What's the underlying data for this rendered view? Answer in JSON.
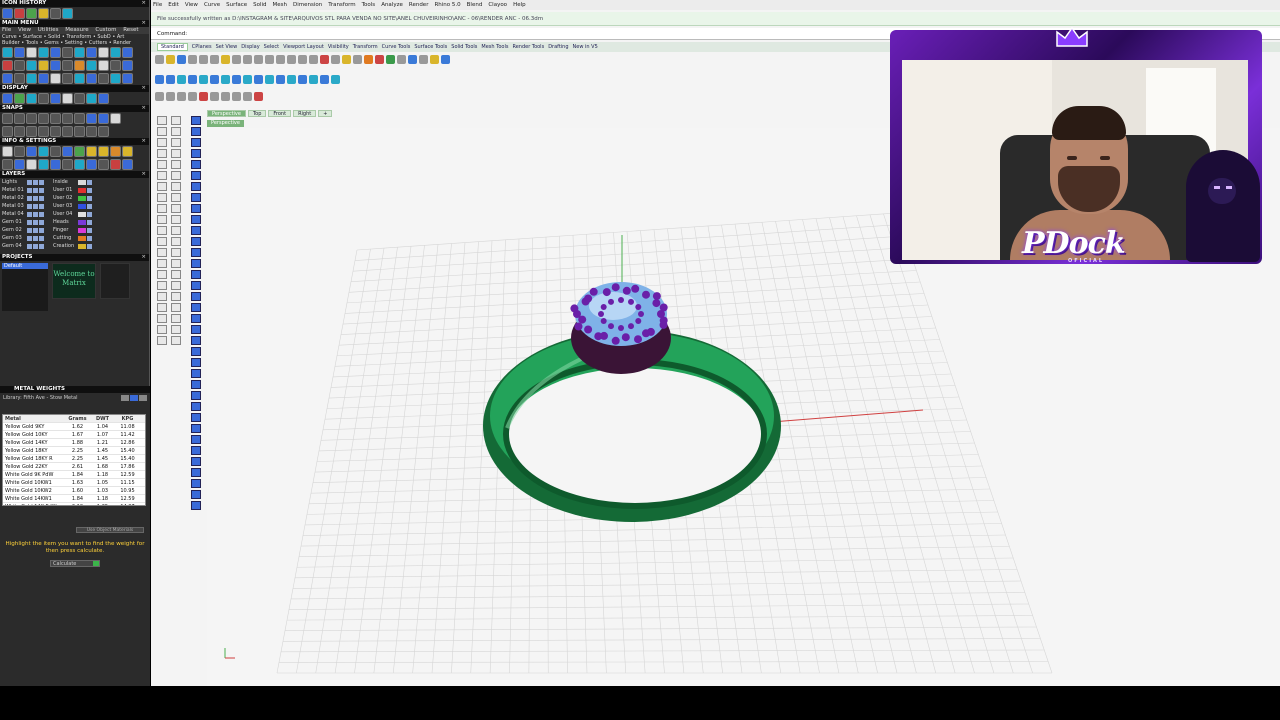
{
  "left_panel": {
    "icon_history_title": "ICON HISTORY",
    "main_menu_title": "MAIN MENU",
    "main_menu_items": [
      "File",
      "View",
      "Utilities",
      "Measure",
      "Custom",
      "Reset"
    ],
    "menu_rows": [
      "Curve • Surface • Solid • Transform • SubD • Art",
      "Builder • Tools • Gems • Setting • Cutters • Render"
    ],
    "display_title": "DISPLAY",
    "snaps_title": "SNAPS",
    "info_title": "INFO & SETTINGS",
    "layers_title": "LAYERS",
    "layers": [
      {
        "name": "Lights",
        "user": "Inside",
        "color": "#d9d9d9"
      },
      {
        "name": "Metal 01",
        "user": "User 01",
        "color": "#e03030"
      },
      {
        "name": "Metal 02",
        "user": "User 02",
        "color": "#40c040"
      },
      {
        "name": "Metal 03",
        "user": "User 03",
        "color": "#3050e0"
      },
      {
        "name": "Metal 04",
        "user": "User 04",
        "color": "#e0e0e0"
      },
      {
        "name": "Gem 01",
        "user": "Heads",
        "color": "#7a3ad8"
      },
      {
        "name": "Gem 02",
        "user": "Finger",
        "color": "#d83ad8"
      },
      {
        "name": "Gem 03",
        "user": "Cutting",
        "color": "#e07a20"
      },
      {
        "name": "Gem 04",
        "user": "Creation",
        "color": "#d9b52b"
      }
    ],
    "projects_title": "PROJECTS",
    "projects_default": "Default",
    "projects_thumb_text": "Welcome to Matrix",
    "metal_weights_title": "METAL WEIGHTS",
    "metal_library_label": "Library: Fifth Ave - Stow Metal",
    "metal_table_headers": [
      "Metal",
      "Grams",
      "DWT",
      "KPG"
    ],
    "metal_table_rows": [
      [
        "Yellow Gold 9KY",
        "1.62",
        "1.04",
        "11.08"
      ],
      [
        "Yellow Gold 10KY",
        "1.67",
        "1.07",
        "11.42"
      ],
      [
        "Yellow Gold 14KY",
        "1.88",
        "1.21",
        "12.86"
      ],
      [
        "Yellow Gold 18KY",
        "2.25",
        "1.45",
        "15.40"
      ],
      [
        "Yellow Gold 18KY R",
        "2.25",
        "1.45",
        "15.40"
      ],
      [
        "Yellow Gold 22KY",
        "2.61",
        "1.68",
        "17.86"
      ],
      [
        "White Gold 9K PdW",
        "1.84",
        "1.18",
        "12.59"
      ],
      [
        "White Gold 10KW1",
        "1.63",
        "1.05",
        "11.15"
      ],
      [
        "White Gold 10KW2",
        "1.60",
        "1.03",
        "10.95"
      ],
      [
        "White Gold 14KW1",
        "1.84",
        "1.18",
        "12.59"
      ],
      [
        "White Gold 14K PdW",
        "2.10",
        "1.35",
        "14.37"
      ]
    ],
    "use_object_materials": "Use Object Materials",
    "hint_text": "Highlight the item you want to find the weight for then press calculate.",
    "calculate_label": "Calculate"
  },
  "main": {
    "top_menu": [
      "File",
      "Edit",
      "View",
      "Curve",
      "Surface",
      "Solid",
      "Mesh",
      "Dimension",
      "Transform",
      "Tools",
      "Analyze",
      "Render",
      "Rhino 5.0",
      "Blend",
      "Clayoo",
      "Help"
    ],
    "status_message": "File successfully written as D:\\INSTAGRAM & SITE\\ARQUIVOS STL PARA VENDA NO SITE\\ANEL CHUVEIRINHO\\ANC - 06\\RENDER ANC - 06.3dm",
    "command_label": "Command:",
    "toolbar_tabs": [
      "Standard",
      "CPlanes",
      "Set View",
      "Display",
      "Select",
      "Viewport Layout",
      "Visibility",
      "Transform",
      "Curve Tools",
      "Surface Tools",
      "Solid Tools",
      "Mesh Tools",
      "Render Tools",
      "Drafting",
      "New in V5"
    ],
    "viewport_tabs": [
      "Perspective",
      "Top",
      "Front",
      "Right"
    ],
    "active_viewport_tab": "Perspective",
    "viewport_label": "Perspective"
  },
  "webcam": {
    "logo_text": "PDock",
    "logo_sub": "OFICIAL"
  },
  "colors": {
    "ring_green": "#1f8a4a",
    "gem_purple": "#6a1fa8",
    "gem_blue": "#7fb2e8",
    "frame_purple": "#6a1fb8"
  }
}
